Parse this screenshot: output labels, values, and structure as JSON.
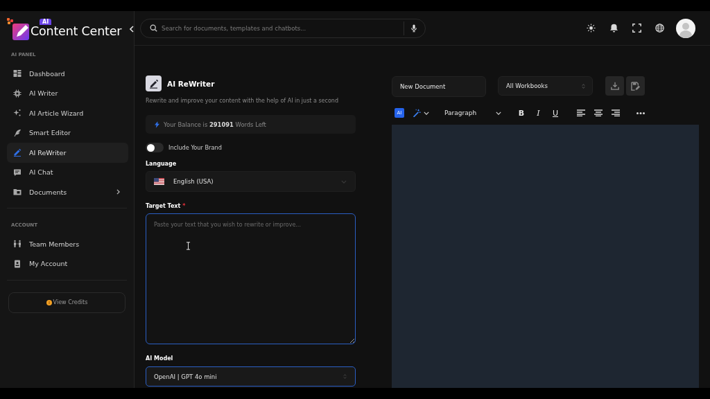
{
  "logo": {
    "badge": "AI",
    "name": "Content Center"
  },
  "sidebar": {
    "sections": [
      {
        "heading": "AI PANEL",
        "items": [
          {
            "label": "Dashboard",
            "kind": "link",
            "selected": false
          },
          {
            "label": "AI Writer",
            "kind": "link",
            "selected": false
          },
          {
            "label": "AI Article Wizard",
            "kind": "link",
            "selected": false
          },
          {
            "label": "Smart Editor",
            "kind": "link",
            "selected": false
          },
          {
            "label": "AI ReWriter",
            "kind": "link",
            "selected": true
          },
          {
            "label": "AI Chat",
            "kind": "link",
            "selected": false
          },
          {
            "label": "Documents",
            "kind": "submenu",
            "selected": false
          }
        ]
      },
      {
        "heading": "ACCOUNT",
        "items": [
          {
            "label": "Team Members",
            "kind": "link",
            "selected": false
          },
          {
            "label": "My Account",
            "kind": "link",
            "selected": false
          }
        ]
      }
    ],
    "credits_button": "View Credits"
  },
  "search": {
    "placeholder": "Search for documents, templates and chatbots..."
  },
  "rewriter": {
    "title": "AI ReWriter",
    "subtitle": "Rewrite and improve your content with the help of AI in just a second",
    "balance": "Your Balance is **291091** Words Left",
    "brand_toggle": {
      "label": "Include Your Brand",
      "on": false
    },
    "language": {
      "label": "Language",
      "value": "English (USA)",
      "focused": false
    },
    "target_text": {
      "label": "Target Text",
      "required_mark": "*",
      "placeholder": "Paste your text that you wish to rewrite or improve...",
      "focused": true
    },
    "ai_model": {
      "label": "AI Model",
      "value": "OpenAI | GPT 4o mini",
      "focused": true
    }
  },
  "editor": {
    "document_name": "New Document",
    "workbook": "All Workbooks",
    "toolbar": {
      "ai_badge": "AI",
      "block_format": "Paragraph",
      "format_buttons": [
        {
          "label": "B",
          "kind": "bold"
        },
        {
          "label": "I",
          "kind": "italic"
        },
        {
          "label": "U",
          "kind": "underline"
        }
      ]
    }
  }
}
